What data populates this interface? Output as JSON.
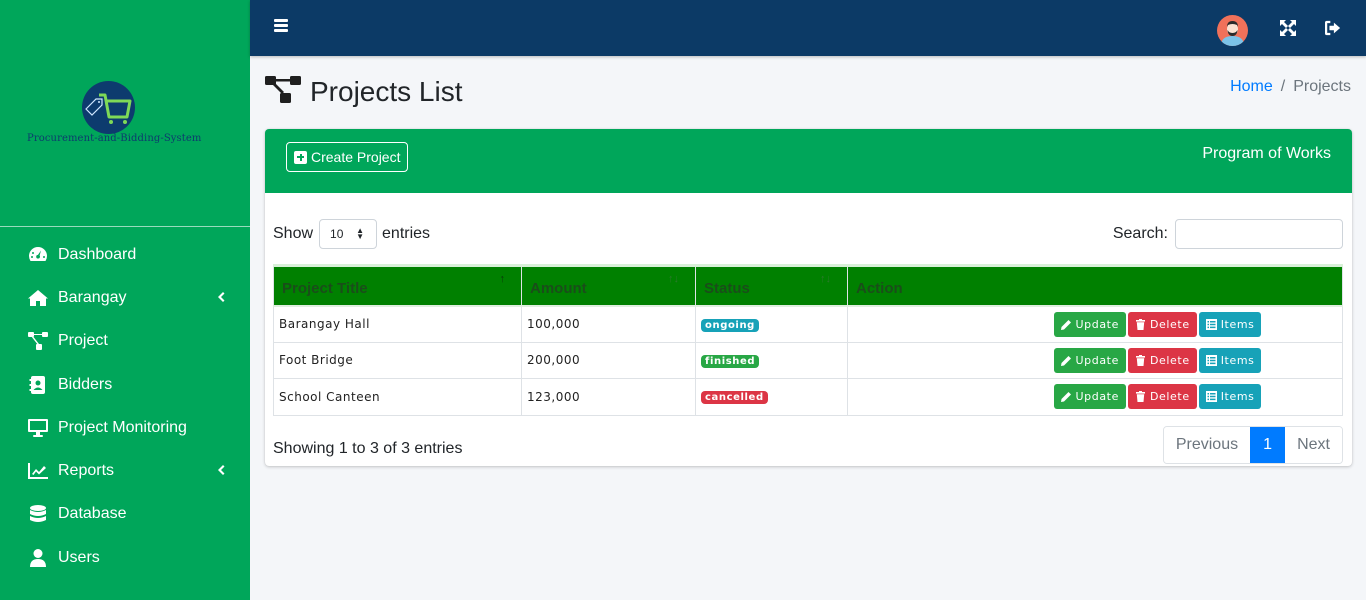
{
  "brand": {
    "name": "Procurement-and-Bidding-System",
    "colors": {
      "sidebar": "#00a65a",
      "logo_circle": "#0d3b6e",
      "cart": "#7ed957"
    }
  },
  "sidebar": {
    "items": [
      {
        "label": "Dashboard",
        "icon": "tachometer-icon",
        "has_submenu": false
      },
      {
        "label": "Barangay",
        "icon": "home-icon",
        "has_submenu": true
      },
      {
        "label": "Project",
        "icon": "sitemap-icon",
        "has_submenu": false
      },
      {
        "label": "Bidders",
        "icon": "address-book-icon",
        "has_submenu": false
      },
      {
        "label": "Project Monitoring",
        "icon": "desktop-icon",
        "has_submenu": false
      },
      {
        "label": "Reports",
        "icon": "chart-line-icon",
        "has_submenu": true
      },
      {
        "label": "Database",
        "icon": "database-icon",
        "has_submenu": false
      },
      {
        "label": "Users",
        "icon": "user-icon",
        "has_submenu": false
      }
    ]
  },
  "topbar": {
    "menu_icon": "bars-icon",
    "avatar_icon": "user-avatar",
    "fullscreen_icon": "expand-icon",
    "logout_icon": "sign-out-icon",
    "color": "#0c3a66"
  },
  "header": {
    "title": "Projects List",
    "title_icon": "sitemap-icon",
    "breadcrumb": [
      {
        "label": "Home",
        "link": true
      },
      {
        "label": "Projects",
        "link": false
      }
    ],
    "breadcrumb_separator": "/"
  },
  "card": {
    "create_button": "Create Project",
    "title": "Program of Works"
  },
  "table_controls": {
    "show_label": "Show",
    "length_value": "10",
    "entries_label": "entries",
    "search_label": "Search:",
    "search_value": "",
    "search_placeholder": ""
  },
  "table": {
    "columns": [
      "Project Title",
      "Amount",
      "Status",
      "Action"
    ],
    "rows": [
      {
        "title": "Barangay Hall",
        "amount": "100,000",
        "status": "ongoing",
        "status_color": "#17a2b8"
      },
      {
        "title": "Foot Bridge",
        "amount": "200,000",
        "status": "finished",
        "status_color": "#28a745"
      },
      {
        "title": "School Canteen",
        "amount": "123,000",
        "status": "cancelled",
        "status_color": "#dc3545"
      }
    ],
    "actions": {
      "update": "Update",
      "delete": "Delete",
      "items": "Items"
    },
    "header_color": "#008000"
  },
  "footer": {
    "info": "Showing 1 to 3 of 3 entries",
    "pagination": {
      "previous": "Previous",
      "current": "1",
      "next": "Next"
    },
    "active_color": "#007bff"
  }
}
